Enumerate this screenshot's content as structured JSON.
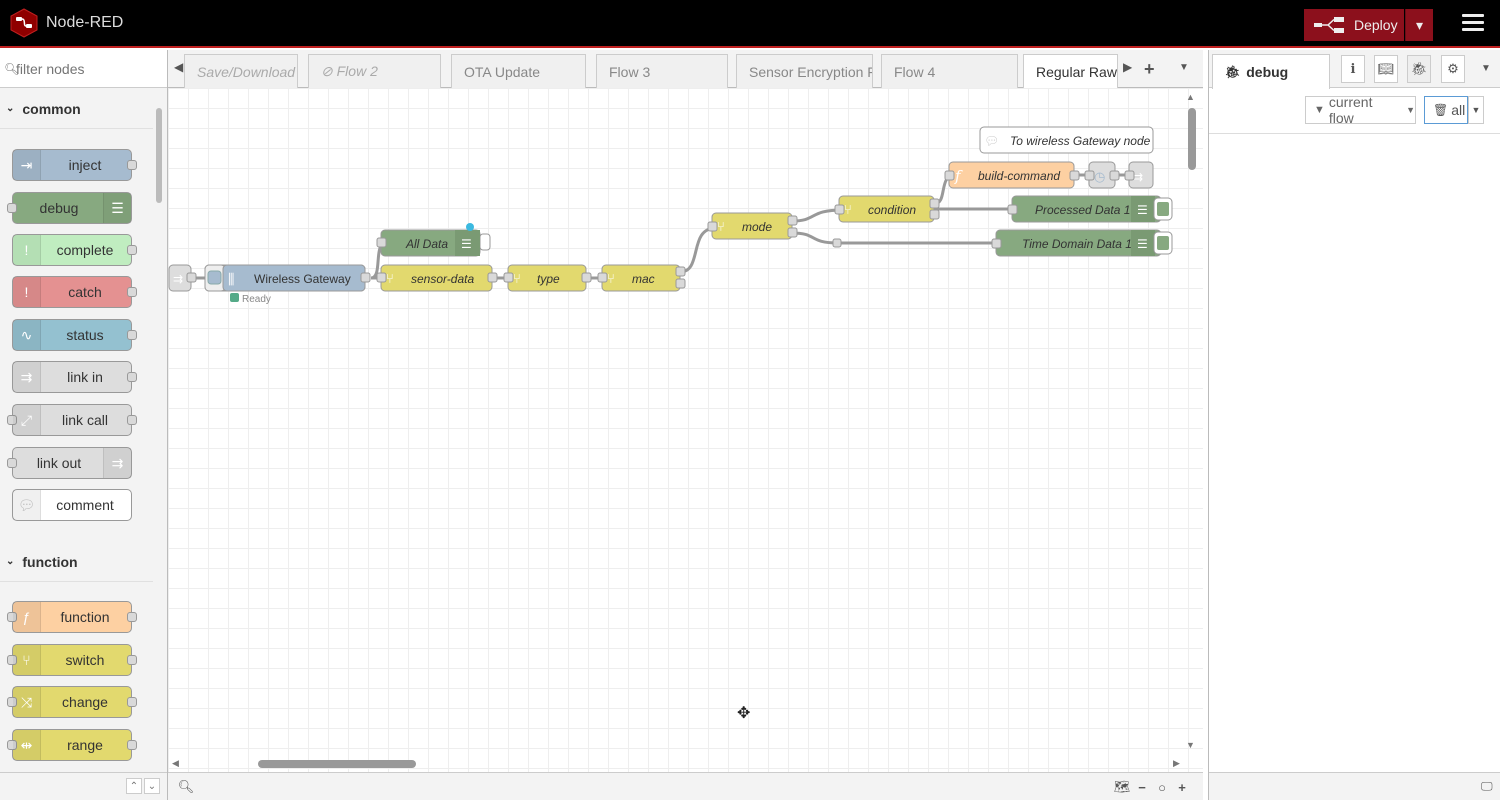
{
  "header": {
    "title": "Node-RED",
    "deploy_label": "Deploy"
  },
  "palette": {
    "search_placeholder": "filter nodes",
    "categories": [
      {
        "label": "common"
      },
      {
        "label": "function"
      }
    ],
    "nodes": [
      {
        "label": "inject",
        "color": "#a6bbcf",
        "icon": "arrow-in-icon",
        "side": "left",
        "ports": "out"
      },
      {
        "label": "debug",
        "color": "#87a980",
        "icon": "list-icon",
        "side": "right",
        "ports": "in"
      },
      {
        "label": "complete",
        "color": "#c0edc0",
        "icon": "exclamation-icon",
        "side": "left",
        "ports": "out"
      },
      {
        "label": "catch",
        "color": "#e49191",
        "icon": "exclamation-icon",
        "side": "left",
        "ports": "out"
      },
      {
        "label": "status",
        "color": "#94c1d0",
        "icon": "pulse-icon",
        "side": "left",
        "ports": "out"
      },
      {
        "label": "link in",
        "color": "#dddddd",
        "icon": "link-in-icon",
        "side": "left",
        "ports": "out"
      },
      {
        "label": "link call",
        "color": "#dddddd",
        "icon": "link-call-icon",
        "side": "left",
        "ports": "both"
      },
      {
        "label": "link out",
        "color": "#dddddd",
        "icon": "link-out-icon",
        "side": "right",
        "ports": "in"
      },
      {
        "label": "comment",
        "color": "#ffffff",
        "icon": "comment-icon",
        "side": "left",
        "ports": "none"
      },
      {
        "label": "function",
        "color": "#fdd0a2",
        "icon": "function-icon",
        "side": "left",
        "ports": "both"
      },
      {
        "label": "switch",
        "color": "#e2d96e",
        "icon": "switch-icon",
        "side": "left",
        "ports": "both"
      },
      {
        "label": "change",
        "color": "#e2d96e",
        "icon": "shuffle-icon",
        "side": "left",
        "ports": "both"
      },
      {
        "label": "range",
        "color": "#e2d96e",
        "icon": "range-icon",
        "side": "left",
        "ports": "both"
      }
    ]
  },
  "tabs": [
    {
      "label": "Save/Download (",
      "state": "disabled"
    },
    {
      "label": "⊘ Flow 2",
      "state": "disabled"
    },
    {
      "label": "OTA Update",
      "state": "normal"
    },
    {
      "label": "Flow 3",
      "state": "normal"
    },
    {
      "label": "Sensor Encryption F",
      "state": "normal"
    },
    {
      "label": "Flow 4",
      "state": "normal"
    },
    {
      "label": "Regular Raw",
      "state": "active"
    }
  ],
  "flow": {
    "nodes": [
      {
        "id": "gw",
        "label": "Wireless Gateway",
        "status": "Ready"
      },
      {
        "id": "alldata",
        "label": "All Data"
      },
      {
        "id": "sensordata",
        "label": "sensor-data"
      },
      {
        "id": "type",
        "label": "type"
      },
      {
        "id": "mac",
        "label": "mac"
      },
      {
        "id": "mode",
        "label": "mode"
      },
      {
        "id": "condition",
        "label": "condition"
      },
      {
        "id": "buildcmd",
        "label": "build-command"
      },
      {
        "id": "proc",
        "label": "Processed Data 1"
      },
      {
        "id": "time",
        "label": "Time Domain Data 1"
      },
      {
        "id": "comment",
        "label": "To wireless Gateway node"
      }
    ]
  },
  "sidebar": {
    "tab_label": "debug",
    "filter_label": "current flow",
    "clear_label": "all"
  }
}
